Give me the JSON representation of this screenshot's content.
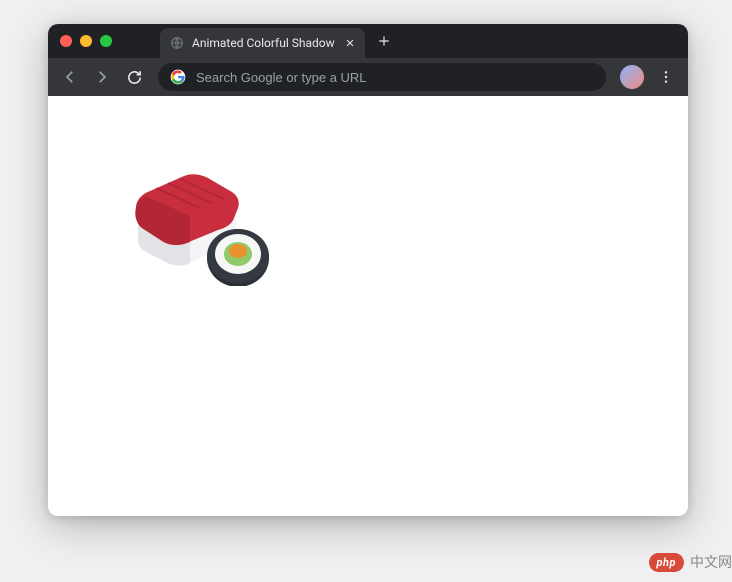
{
  "browser": {
    "tab": {
      "title": "Animated Colorful Shadow"
    },
    "omnibox": {
      "placeholder": "Search Google or type a URL",
      "value": ""
    }
  },
  "watermark": {
    "badge": "php",
    "text": "中文网"
  },
  "content": {
    "image_name": "sushi-illustration"
  }
}
